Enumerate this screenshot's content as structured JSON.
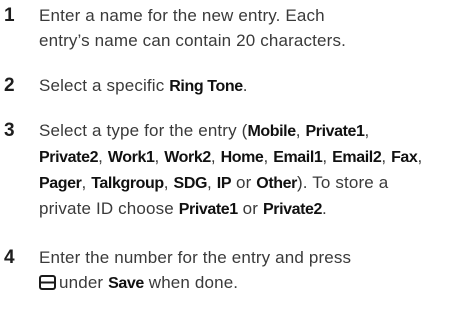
{
  "steps": [
    {
      "number": "1",
      "line1": "Enter a name for the new entry. Each",
      "line2": "entry’s name can contain 20 characters."
    },
    {
      "number": "2",
      "pre": "Select a specific ",
      "term": "Ring Tone",
      "post": "."
    },
    {
      "number": "3",
      "pre": "Select a type for the entry (",
      "types": [
        "Mobile",
        "Private1",
        "Private2",
        "Work1",
        "Work2",
        "Home",
        "Email1",
        "Email2",
        "Fax",
        "Pager",
        "Talkgroup",
        "SDG",
        "IP",
        "Other"
      ],
      "or_word": "or",
      "close": "). To store a",
      "private_pre": "private ID choose ",
      "private_end": "."
    },
    {
      "number": "4",
      "line1": "Enter the number for the entry and press",
      "under": "under",
      "softkey": "Save",
      "done": "when done.",
      "icon": "softkey-icon"
    }
  ]
}
